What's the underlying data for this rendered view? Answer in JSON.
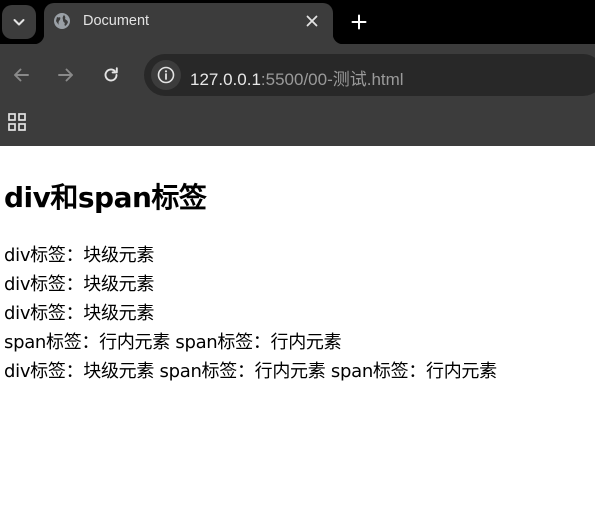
{
  "browser": {
    "tab": {
      "title": "Document"
    },
    "address": {
      "host": "127.0.0.1",
      "rest": ":5500/00-测试.html"
    },
    "colors": {
      "tabstrip": "#000000",
      "toolbar": "#3c3c3c",
      "omnibox": "#282828"
    }
  },
  "page": {
    "heading": "div和span标签",
    "lines": [
      {
        "items": [
          "div标签：块级元素"
        ]
      },
      {
        "items": [
          "div标签：块级元素"
        ]
      },
      {
        "items": [
          "div标签：块级元素"
        ]
      },
      {
        "items": [
          "span标签：行内元素",
          "span标签：行内元素"
        ]
      },
      {
        "items": [
          "div标签：块级元素",
          "span标签：行内元素",
          "span标签：行内元素"
        ]
      }
    ]
  }
}
